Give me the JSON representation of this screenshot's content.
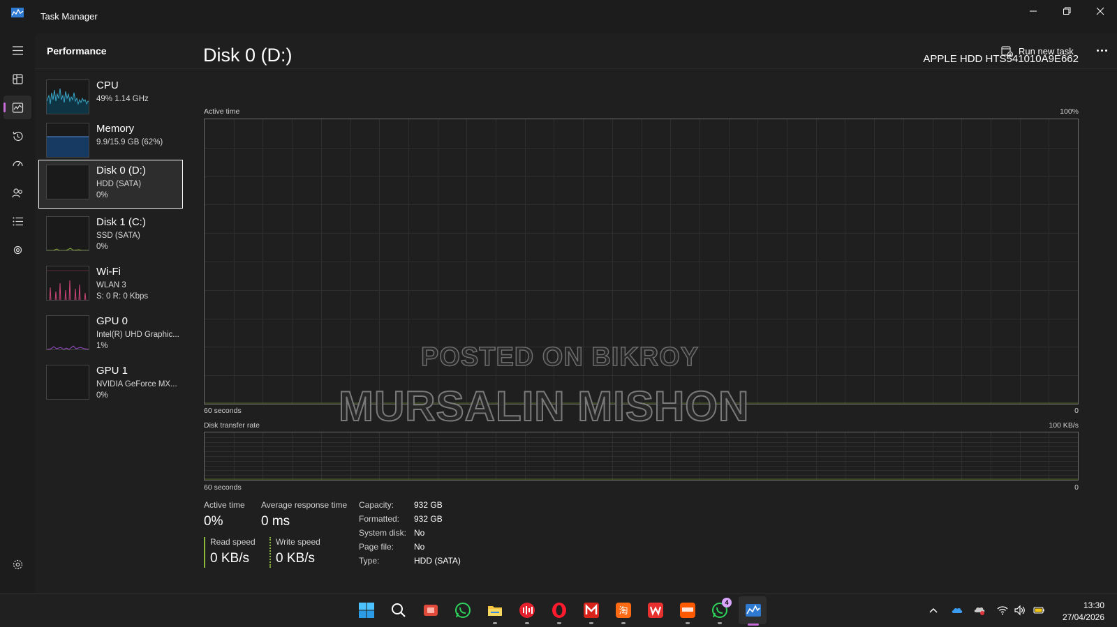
{
  "window": {
    "title": "Task Manager"
  },
  "header": {
    "page_title": "Performance",
    "run_new_task": "Run new task"
  },
  "devices": [
    {
      "name": "CPU",
      "sub1": "49%  1.14 GHz",
      "sub2": "",
      "color": "#3aa6c8"
    },
    {
      "name": "Memory",
      "sub1": "9.9/15.9 GB (62%)",
      "sub2": "",
      "color": "#5b8fd6"
    },
    {
      "name": "Disk 0 (D:)",
      "sub1": "HDD (SATA)",
      "sub2": "0%",
      "color": "#8fb83a"
    },
    {
      "name": "Disk 1 (C:)",
      "sub1": "SSD (SATA)",
      "sub2": "0%",
      "color": "#8fb83a"
    },
    {
      "name": "Wi-Fi",
      "sub1": "WLAN 3",
      "sub2": "S: 0  R: 0 Kbps",
      "color": "#d1467a"
    },
    {
      "name": "GPU 0",
      "sub1": "Intel(R) UHD Graphic...",
      "sub2": "1%",
      "color": "#9b4fc9"
    },
    {
      "name": "GPU 1",
      "sub1": "NVIDIA GeForce MX...",
      "sub2": "0%",
      "color": "#9b4fc9"
    }
  ],
  "disk": {
    "title": "Disk 0 (D:)",
    "model": "APPLE HDD HTS541010A9E662",
    "graph1": {
      "label": "Active time",
      "max": "100%",
      "x_label": "60 seconds",
      "min": "0"
    },
    "graph2": {
      "label": "Disk transfer rate",
      "max": "100 KB/s",
      "x_label": "60 seconds",
      "min": "0"
    },
    "stats": {
      "active_time_label": "Active time",
      "active_time_value": "0%",
      "avg_response_label": "Average response time",
      "avg_response_value": "0 ms",
      "read_speed_label": "Read speed",
      "read_speed_value": "0 KB/s",
      "write_speed_label": "Write speed",
      "write_speed_value": "0 KB/s"
    },
    "properties": [
      {
        "key": "Capacity:",
        "value": "932 GB"
      },
      {
        "key": "Formatted:",
        "value": "932 GB"
      },
      {
        "key": "System disk:",
        "value": "No"
      },
      {
        "key": "Page file:",
        "value": "No"
      },
      {
        "key": "Type:",
        "value": "HDD (SATA)"
      }
    ]
  },
  "watermark": {
    "line1": "POSTED ON BIKROY",
    "line2": "MURSALIN MISHON"
  },
  "taskbar": {
    "whatsapp_badge": "4",
    "time": "13:30",
    "date": "27/04/2026"
  },
  "accent_color": "#c76bd8"
}
